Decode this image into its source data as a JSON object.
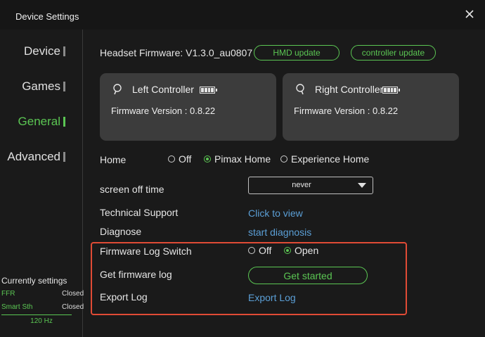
{
  "window": {
    "title": "Device Settings"
  },
  "sidebar": {
    "items": [
      {
        "label": "Device"
      },
      {
        "label": "Games"
      },
      {
        "label": "General"
      },
      {
        "label": "Advanced"
      }
    ],
    "current_settings": {
      "title": "Currently settings",
      "rows": [
        {
          "key": "FFR",
          "value": "Closed"
        },
        {
          "key": "Smart Sth",
          "value": "Closed"
        }
      ],
      "refresh_rate": "120 Hz"
    }
  },
  "firmware": {
    "label": "Headset Firmware: V1.3.0_au0807",
    "hmd_update": "HMD update",
    "controller_update": "controller update"
  },
  "controllers": {
    "left": {
      "title": "Left Controller",
      "firmware": "Firmware Version : 0.8.22",
      "battery_bars": 4
    },
    "right": {
      "title": "Right Controller",
      "firmware": "Firmware Version : 0.8.22",
      "battery_bars": 4
    }
  },
  "home": {
    "label": "Home",
    "options": [
      "Off",
      "Pimax Home",
      "Experience Home"
    ],
    "selected": "Pimax Home"
  },
  "screen_off": {
    "label": "screen off time",
    "value": "never"
  },
  "tech_support": {
    "label": "Technical Support",
    "link": "Click to view"
  },
  "diagnose": {
    "label": "Diagnose",
    "link": "start diagnosis"
  },
  "firmware_log": {
    "label": "Firmware Log Switch",
    "options": [
      "Off",
      "Open"
    ],
    "selected": "Open"
  },
  "get_log": {
    "label": "Get firmware log",
    "button": "Get started"
  },
  "export_log": {
    "label": "Export Log",
    "link": "Export Log"
  },
  "colors": {
    "accent": "#5bc653",
    "link": "#5b9fd6",
    "highlight": "#e04b35",
    "card": "#3c3c3c"
  }
}
